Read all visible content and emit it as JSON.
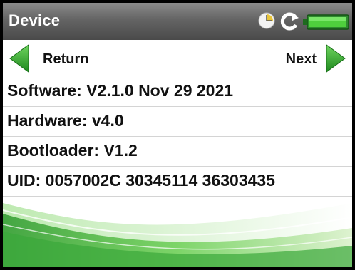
{
  "header": {
    "title": "Device",
    "icons": [
      "clock-icon",
      "refresh-icon",
      "battery-icon"
    ]
  },
  "nav": {
    "back_label": "Return",
    "next_label": "Next"
  },
  "info": {
    "rows": [
      "Software: V2.1.0 Nov 29 2021",
      "Hardware: v4.0",
      "Bootloader: V1.2",
      "UID: 0057002C 30345114 36303435"
    ]
  },
  "colors": {
    "accent_green": "#3aa83a",
    "header_gray": "#646464"
  }
}
